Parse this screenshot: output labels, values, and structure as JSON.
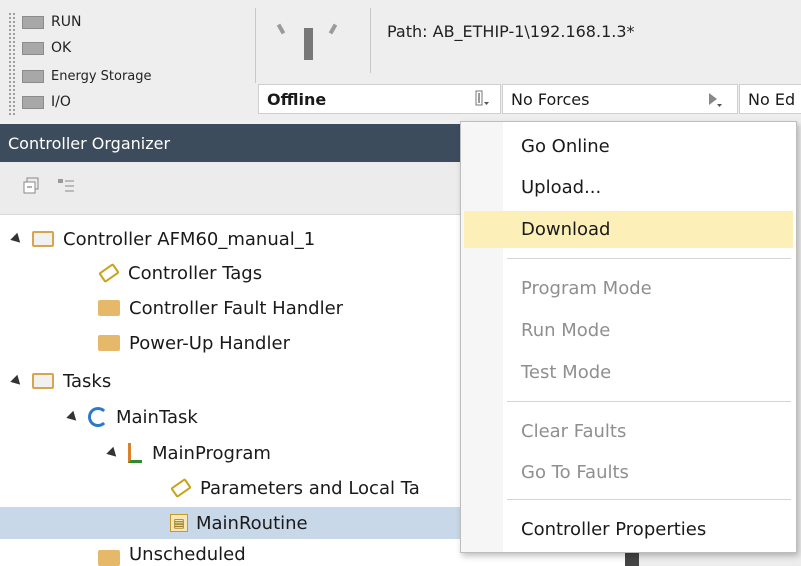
{
  "status_indicators": [
    {
      "label": "RUN"
    },
    {
      "label": "OK"
    },
    {
      "label": "Energy Storage"
    },
    {
      "label": "I/O"
    }
  ],
  "path_label": "Path: AB_ETHIP-1\\192.168.1.3*",
  "online_status": "Offline",
  "forces_status": "No Forces",
  "edits_status": "No Ed",
  "organizer_title": "Controller Organizer",
  "tree": {
    "controller": "Controller AFM60_manual_1",
    "controller_tags": "Controller Tags",
    "fault_handler": "Controller Fault Handler",
    "powerup_handler": "Power-Up Handler",
    "tasks": "Tasks",
    "main_task": "MainTask",
    "main_program": "MainProgram",
    "parameters": "Parameters and Local Ta",
    "main_routine": "MainRoutine",
    "unscheduled": "Unscheduled"
  },
  "menu": {
    "go_online": "Go Online",
    "upload": "Upload...",
    "download": "Download",
    "program_mode": "Program Mode",
    "run_mode": "Run Mode",
    "test_mode": "Test Mode",
    "clear_faults": "Clear Faults",
    "go_to_faults": "Go To Faults",
    "controller_properties": "Controller Properties"
  },
  "colors": {
    "organizer_header": "#3d4c5d",
    "menu_highlight": "#fcefb8",
    "selected_row": "#c9d8e8"
  }
}
